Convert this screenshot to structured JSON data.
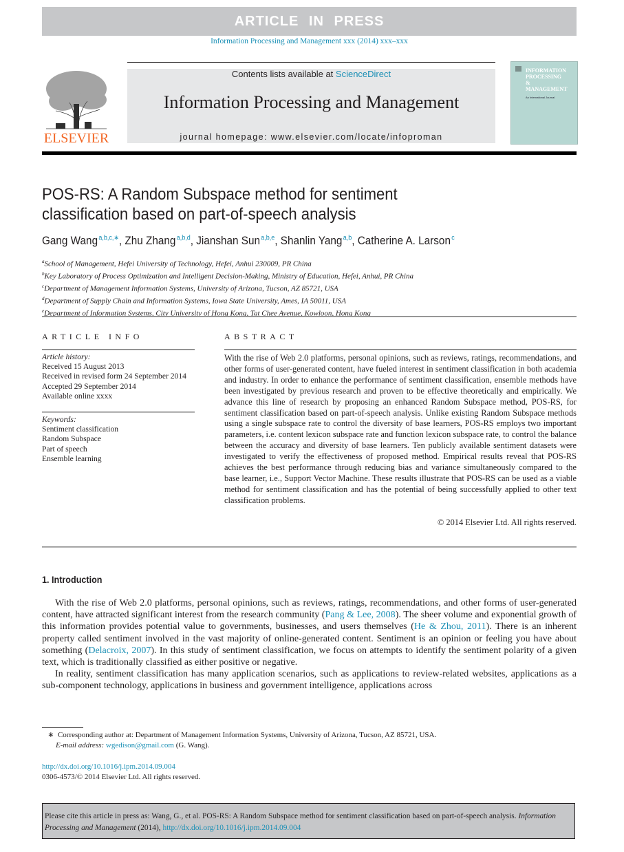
{
  "banner": {
    "label": "ARTICLE IN PRESS"
  },
  "journal_ref": "Information Processing and Management xxx (2014) xxx–xxx",
  "masthead": {
    "publisher": "ELSEVIER",
    "contents_prefix": "Contents lists available at ",
    "contents_link": "ScienceDirect",
    "journal_title": "Information Processing and Management",
    "homepage_prefix": "journal homepage: ",
    "homepage_url": "www.elsevier.com/locate/infoproman",
    "cover": {
      "title_lines": [
        "INFORMATION",
        "PROCESSING",
        "&",
        "MANAGEMENT"
      ],
      "subtitle": "An International Journal",
      "color": "#b6d7d2"
    }
  },
  "article": {
    "title": "POS-RS: A Random Subspace method for sentiment classification based on part-of-speech analysis",
    "authors": [
      {
        "name": "Gang Wang",
        "affil": "a,b,c,∗"
      },
      {
        "name": "Zhu Zhang",
        "affil": "a,b,d"
      },
      {
        "name": "Jianshan Sun",
        "affil": "a,b,e"
      },
      {
        "name": "Shanlin Yang",
        "affil": "a,b"
      },
      {
        "name": "Catherine A. Larson",
        "affil": "c"
      }
    ],
    "affiliations": [
      {
        "key": "a",
        "text": "School of Management, Hefei University of Technology, Hefei, Anhui 230009, PR China"
      },
      {
        "key": "b",
        "text": "Key Laboratory of Process Optimization and Intelligent Decision-Making, Ministry of Education, Hefei, Anhui, PR China"
      },
      {
        "key": "c",
        "text": "Department of Management Information Systems, University of Arizona, Tucson, AZ 85721, USA"
      },
      {
        "key": "d",
        "text": "Department of Supply Chain and Information Systems, Iowa State University, Ames, IA 50011, USA"
      },
      {
        "key": "e",
        "text": "Department of Information Systems, City University of Hong Kong, Tat Chee Avenue, Kowloon, Hong Kong"
      }
    ]
  },
  "article_info": {
    "heading": "ARTICLE INFO",
    "history_label": "Article history:",
    "history": [
      "Received 15 August 2013",
      "Received in revised form 24 September 2014",
      "Accepted 29 September 2014",
      "Available online xxxx"
    ],
    "keywords_label": "Keywords:",
    "keywords": [
      "Sentiment classification",
      "Random Subspace",
      "Part of speech",
      "Ensemble learning"
    ]
  },
  "abstract": {
    "heading": "ABSTRACT",
    "text": "With the rise of Web 2.0 platforms, personal opinions, such as reviews, ratings, recommendations, and other forms of user-generated content, have fueled interest in sentiment classification in both academia and industry. In order to enhance the performance of sentiment classification, ensemble methods have been investigated by previous research and proven to be effective theoretically and empirically. We advance this line of research by proposing an enhanced Random Subspace method, POS-RS, for sentiment classification based on part-of-speech analysis. Unlike existing Random Subspace methods using a single subspace rate to control the diversity of base learners, POS-RS employs two important parameters, i.e. content lexicon subspace rate and function lexicon subspace rate, to control the balance between the accuracy and diversity of base learners. Ten publicly available sentiment datasets were investigated to verify the effectiveness of proposed method. Empirical results reveal that POS-RS achieves the best performance through reducing bias and variance simultaneously compared to the base learner, i.e., Support Vector Machine. These results illustrate that POS-RS can be used as a viable method for sentiment classification and has the potential of being successfully applied to other text classification problems.",
    "copyright": "© 2014 Elsevier Ltd. All rights reserved."
  },
  "introduction": {
    "heading": "1. Introduction",
    "p1": {
      "t1": "With the rise of Web 2.0 platforms, personal opinions, such as reviews, ratings, recommendations, and other forms of user-generated content, have attracted significant interest from the research community (",
      "c1": "Pang & Lee, 2008",
      "t2": "). The sheer volume and exponential growth of this information provides potential value to governments, businesses, and users themselves (",
      "c2": "He & Zhou, 2011",
      "t3": "). There is an inherent property called sentiment involved in the vast majority of online-generated content. Sentiment is an opinion or feeling you have about something (",
      "c3": "Delacroix, 2007",
      "t4": "). In this study of sentiment classification, we focus on attempts to identify the sentiment polarity of a given text, which is traditionally classified as either positive or negative."
    },
    "p2": "In reality, sentiment classification has many application scenarios, such as applications to review-related websites, applications as a sub-component technology, applications in business and government intelligence, applications across"
  },
  "footnote": {
    "marker": "∗",
    "text": "Corresponding author at: Department of Management Information Systems, University of Arizona, Tucson, AZ 85721, USA.",
    "email_label": "E-mail address:",
    "email": "wgedison@gmail.com",
    "email_suffix": " (G. Wang).",
    "doi": "http://dx.doi.org/10.1016/j.ipm.2014.09.004",
    "issn": "0306-4573/© 2014 Elsevier Ltd. All rights reserved."
  },
  "citation": {
    "prefix": "Please cite this article in press as: Wang, G., et al. POS-RS: A Random Subspace method for sentiment classification based on part-of-speech analysis. ",
    "journal": "Information Processing and Management",
    "year": " (2014), ",
    "doi": "http://dx.doi.org/10.1016/j.ipm.2014.09.004"
  },
  "colors": {
    "link": "#1a8fb5",
    "elsevier_orange": "#f26522",
    "banner_grey": "#c6c7c9"
  }
}
